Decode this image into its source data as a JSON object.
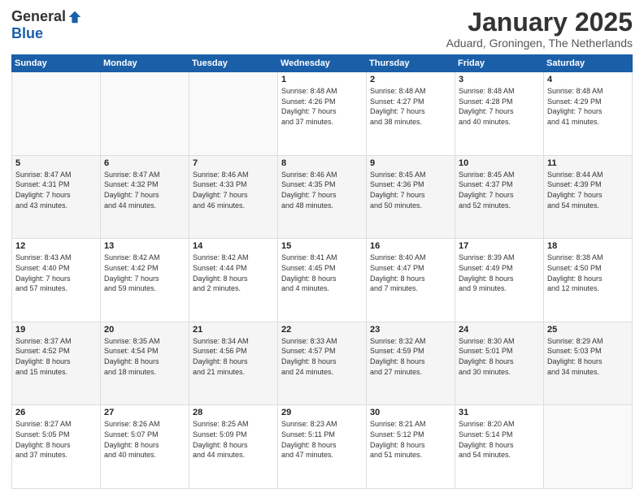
{
  "logo": {
    "general": "General",
    "blue": "Blue"
  },
  "title": "January 2025",
  "location": "Aduard, Groningen, The Netherlands",
  "days_of_week": [
    "Sunday",
    "Monday",
    "Tuesday",
    "Wednesday",
    "Thursday",
    "Friday",
    "Saturday"
  ],
  "weeks": [
    [
      {
        "day": "",
        "info": ""
      },
      {
        "day": "",
        "info": ""
      },
      {
        "day": "",
        "info": ""
      },
      {
        "day": "1",
        "info": "Sunrise: 8:48 AM\nSunset: 4:26 PM\nDaylight: 7 hours\nand 37 minutes."
      },
      {
        "day": "2",
        "info": "Sunrise: 8:48 AM\nSunset: 4:27 PM\nDaylight: 7 hours\nand 38 minutes."
      },
      {
        "day": "3",
        "info": "Sunrise: 8:48 AM\nSunset: 4:28 PM\nDaylight: 7 hours\nand 40 minutes."
      },
      {
        "day": "4",
        "info": "Sunrise: 8:48 AM\nSunset: 4:29 PM\nDaylight: 7 hours\nand 41 minutes."
      }
    ],
    [
      {
        "day": "5",
        "info": "Sunrise: 8:47 AM\nSunset: 4:31 PM\nDaylight: 7 hours\nand 43 minutes."
      },
      {
        "day": "6",
        "info": "Sunrise: 8:47 AM\nSunset: 4:32 PM\nDaylight: 7 hours\nand 44 minutes."
      },
      {
        "day": "7",
        "info": "Sunrise: 8:46 AM\nSunset: 4:33 PM\nDaylight: 7 hours\nand 46 minutes."
      },
      {
        "day": "8",
        "info": "Sunrise: 8:46 AM\nSunset: 4:35 PM\nDaylight: 7 hours\nand 48 minutes."
      },
      {
        "day": "9",
        "info": "Sunrise: 8:45 AM\nSunset: 4:36 PM\nDaylight: 7 hours\nand 50 minutes."
      },
      {
        "day": "10",
        "info": "Sunrise: 8:45 AM\nSunset: 4:37 PM\nDaylight: 7 hours\nand 52 minutes."
      },
      {
        "day": "11",
        "info": "Sunrise: 8:44 AM\nSunset: 4:39 PM\nDaylight: 7 hours\nand 54 minutes."
      }
    ],
    [
      {
        "day": "12",
        "info": "Sunrise: 8:43 AM\nSunset: 4:40 PM\nDaylight: 7 hours\nand 57 minutes."
      },
      {
        "day": "13",
        "info": "Sunrise: 8:42 AM\nSunset: 4:42 PM\nDaylight: 7 hours\nand 59 minutes."
      },
      {
        "day": "14",
        "info": "Sunrise: 8:42 AM\nSunset: 4:44 PM\nDaylight: 8 hours\nand 2 minutes."
      },
      {
        "day": "15",
        "info": "Sunrise: 8:41 AM\nSunset: 4:45 PM\nDaylight: 8 hours\nand 4 minutes."
      },
      {
        "day": "16",
        "info": "Sunrise: 8:40 AM\nSunset: 4:47 PM\nDaylight: 8 hours\nand 7 minutes."
      },
      {
        "day": "17",
        "info": "Sunrise: 8:39 AM\nSunset: 4:49 PM\nDaylight: 8 hours\nand 9 minutes."
      },
      {
        "day": "18",
        "info": "Sunrise: 8:38 AM\nSunset: 4:50 PM\nDaylight: 8 hours\nand 12 minutes."
      }
    ],
    [
      {
        "day": "19",
        "info": "Sunrise: 8:37 AM\nSunset: 4:52 PM\nDaylight: 8 hours\nand 15 minutes."
      },
      {
        "day": "20",
        "info": "Sunrise: 8:35 AM\nSunset: 4:54 PM\nDaylight: 8 hours\nand 18 minutes."
      },
      {
        "day": "21",
        "info": "Sunrise: 8:34 AM\nSunset: 4:56 PM\nDaylight: 8 hours\nand 21 minutes."
      },
      {
        "day": "22",
        "info": "Sunrise: 8:33 AM\nSunset: 4:57 PM\nDaylight: 8 hours\nand 24 minutes."
      },
      {
        "day": "23",
        "info": "Sunrise: 8:32 AM\nSunset: 4:59 PM\nDaylight: 8 hours\nand 27 minutes."
      },
      {
        "day": "24",
        "info": "Sunrise: 8:30 AM\nSunset: 5:01 PM\nDaylight: 8 hours\nand 30 minutes."
      },
      {
        "day": "25",
        "info": "Sunrise: 8:29 AM\nSunset: 5:03 PM\nDaylight: 8 hours\nand 34 minutes."
      }
    ],
    [
      {
        "day": "26",
        "info": "Sunrise: 8:27 AM\nSunset: 5:05 PM\nDaylight: 8 hours\nand 37 minutes."
      },
      {
        "day": "27",
        "info": "Sunrise: 8:26 AM\nSunset: 5:07 PM\nDaylight: 8 hours\nand 40 minutes."
      },
      {
        "day": "28",
        "info": "Sunrise: 8:25 AM\nSunset: 5:09 PM\nDaylight: 8 hours\nand 44 minutes."
      },
      {
        "day": "29",
        "info": "Sunrise: 8:23 AM\nSunset: 5:11 PM\nDaylight: 8 hours\nand 47 minutes."
      },
      {
        "day": "30",
        "info": "Sunrise: 8:21 AM\nSunset: 5:12 PM\nDaylight: 8 hours\nand 51 minutes."
      },
      {
        "day": "31",
        "info": "Sunrise: 8:20 AM\nSunset: 5:14 PM\nDaylight: 8 hours\nand 54 minutes."
      },
      {
        "day": "",
        "info": ""
      }
    ]
  ]
}
